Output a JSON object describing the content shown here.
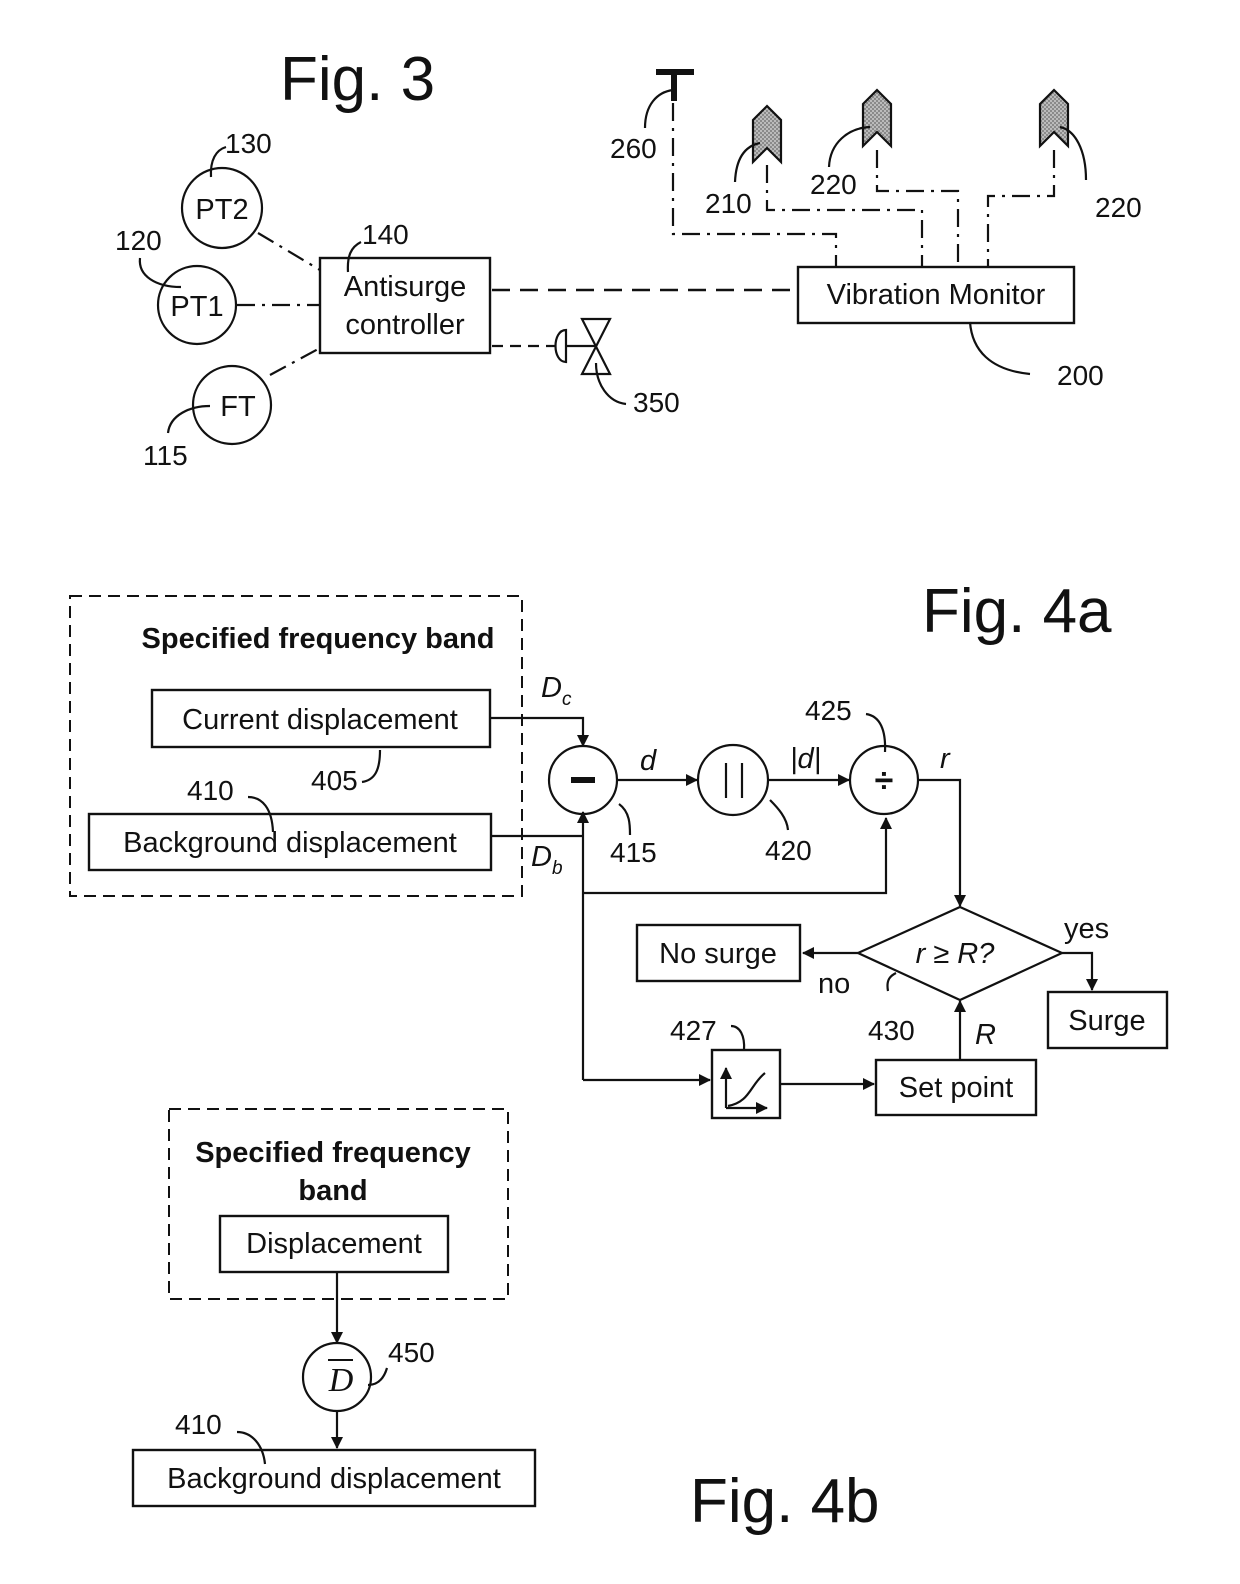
{
  "fig3": {
    "title": "Fig. 3",
    "nodes": {
      "pt2": {
        "label": "PT2",
        "ref": "130"
      },
      "pt1": {
        "label": "PT1",
        "ref": "120"
      },
      "ft": {
        "label": "FT",
        "ref": "115"
      },
      "controller": {
        "line1": "Antisurge",
        "line2": "controller",
        "ref": "140"
      },
      "valve": {
        "ref": "350"
      },
      "vibration_monitor": {
        "label": "Vibration Monitor",
        "ref": "200"
      },
      "sensor_260": {
        "ref": "260"
      },
      "sensor_210": {
        "ref": "210"
      },
      "sensor_220a": {
        "ref": "220"
      },
      "sensor_220b": {
        "ref": "220"
      }
    }
  },
  "fig4a": {
    "title": "Fig. 4a",
    "frame_title": "Specified frequency band",
    "current_displacement": {
      "label": "Current displacement",
      "ref": "405"
    },
    "background_displacement": {
      "label": "Background displacement",
      "ref": "410"
    },
    "signals": {
      "dc": "D",
      "dc_sub": "c",
      "db": "D",
      "db_sub": "b",
      "d": "d",
      "abs_d": "|d|",
      "r": "r",
      "R": "R"
    },
    "subtract": {
      "symbol": "−",
      "ref": "415"
    },
    "absolute": {
      "symbol": "| |",
      "ref": "420"
    },
    "divide": {
      "symbol": "÷",
      "ref": "425"
    },
    "function_block": {
      "ref": "427"
    },
    "decision": {
      "label": "r ≥ R?",
      "ref": "430",
      "yes": "yes",
      "no": "no"
    },
    "no_surge": {
      "label": "No surge"
    },
    "surge": {
      "label": "Surge"
    },
    "set_point": {
      "label": "Set point"
    }
  },
  "fig4b": {
    "title": "Fig. 4b",
    "frame_title_line1": "Specified frequency",
    "frame_title_line2": "band",
    "displacement": {
      "label": "Displacement"
    },
    "average": {
      "symbol": "D",
      "ref": "450"
    },
    "background_displacement": {
      "label": "Background displacement",
      "ref": "410"
    }
  }
}
